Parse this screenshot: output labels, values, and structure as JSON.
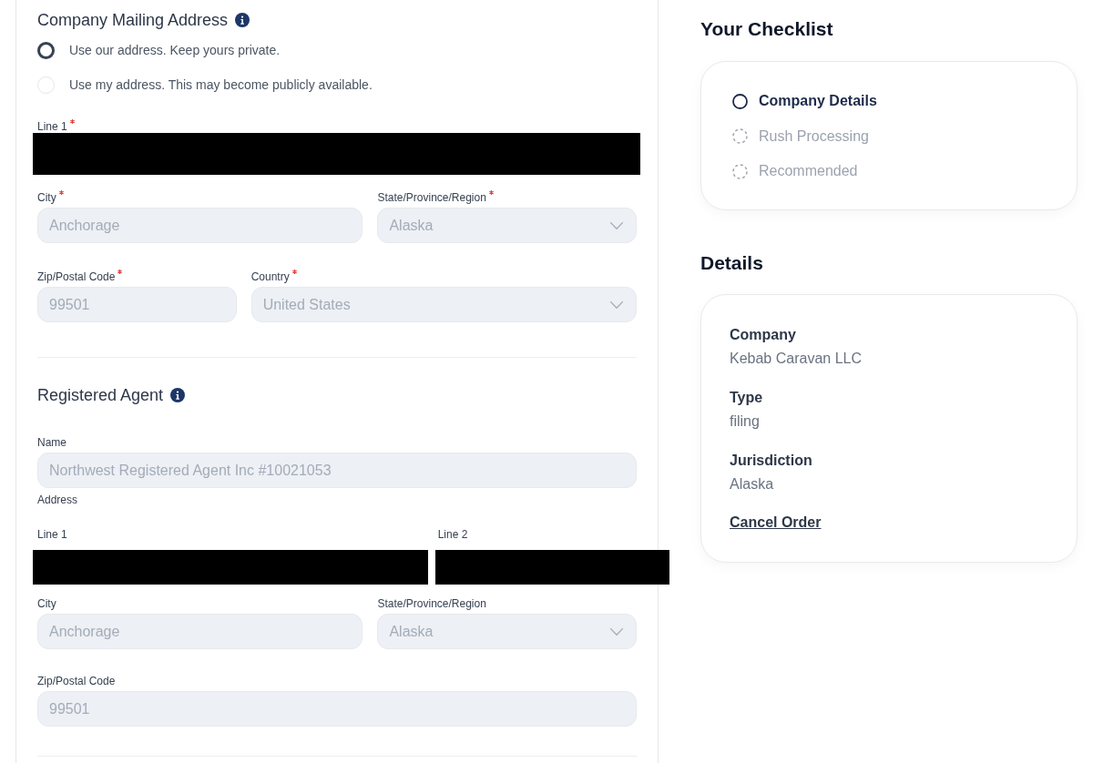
{
  "mailing_address": {
    "title": "Company Mailing Address",
    "options": [
      {
        "label": "Use our address. Keep yours private.",
        "selected": true
      },
      {
        "label": "Use my address. This may become publicly available.",
        "selected": false
      }
    ],
    "rows": [
      [
        {
          "kind": "redacted",
          "label": "Line 1",
          "required": true
        }
      ],
      [
        {
          "kind": "text",
          "label": "City",
          "required": true,
          "value": "Anchorage",
          "disabled": true
        },
        {
          "kind": "select",
          "label": "State/Province/Region",
          "required": true,
          "value": "Alaska",
          "disabled": true
        }
      ],
      [
        {
          "kind": "text",
          "label": "Zip/Postal Code",
          "required": true,
          "value": "99501",
          "disabled": true
        },
        {
          "kind": "select",
          "label": "Country",
          "required": true,
          "value": "United States",
          "disabled": true
        }
      ]
    ]
  },
  "registered_agent": {
    "title": "Registered Agent",
    "name_field": {
      "kind": "text",
      "label": "Name",
      "required": false,
      "value": "Northwest Registered Agent Inc #10021053",
      "disabled": true
    },
    "address_heading": "Address",
    "rows": [
      [
        {
          "kind": "redacted",
          "label": "Line 1",
          "required": false
        },
        {
          "kind": "redacted",
          "label": "Line 2",
          "required": false
        }
      ],
      [
        {
          "kind": "text",
          "label": "City",
          "required": false,
          "value": "Anchorage",
          "disabled": true
        },
        {
          "kind": "select",
          "label": "State/Province/Region",
          "required": false,
          "value": "Alaska",
          "disabled": true
        }
      ],
      [
        {
          "kind": "text",
          "label": "Zip/Postal Code",
          "required": false,
          "value": "99501",
          "disabled": true
        }
      ]
    ]
  },
  "checklist": {
    "title": "Your Checklist",
    "items": [
      {
        "label": "Company Details",
        "active": true
      },
      {
        "label": "Rush Processing",
        "active": false
      },
      {
        "label": "Recommended",
        "active": false
      }
    ]
  },
  "details": {
    "title": "Details",
    "entries": [
      {
        "label": "Company",
        "value": "Kebab Caravan LLC"
      },
      {
        "label": "Type",
        "value": "filing"
      },
      {
        "label": "Jurisdiction",
        "value": "Alaska"
      }
    ],
    "cancel_link": "Cancel Order"
  }
}
